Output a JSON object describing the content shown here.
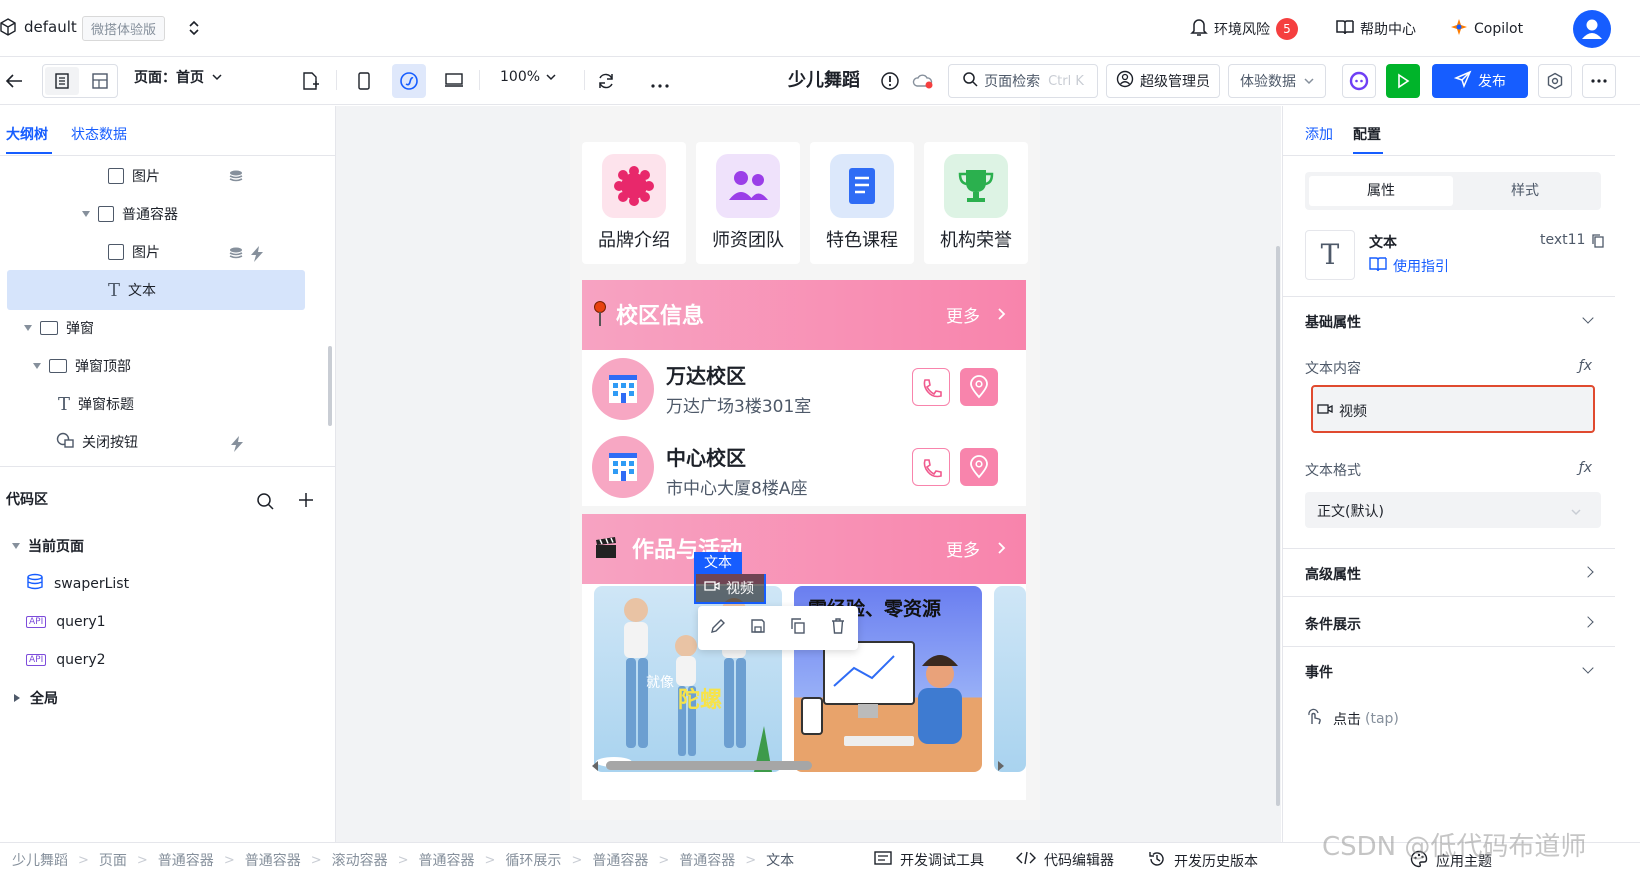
{
  "topbar": {
    "app_name": "default",
    "edition_tag": "微搭体验版",
    "env_risk_label": "环境风险",
    "env_risk_count": "5",
    "help_label": "帮助中心",
    "copilot_label": "Copilot"
  },
  "toolbar": {
    "page_label": "页面：首页",
    "zoom": "100%",
    "app_title": "少儿舞蹈",
    "search_label": "页面检索",
    "search_shortcut": "Ctrl K",
    "user_label": "超级管理员",
    "data_mode": "体验数据",
    "publish_label": "发布"
  },
  "left": {
    "tabs": [
      "大纲树",
      "状态数据"
    ],
    "tree": [
      {
        "label": "图片"
      },
      {
        "label": "普通容器"
      },
      {
        "label": "图片"
      },
      {
        "label": "文本"
      },
      {
        "label": "弹窗"
      },
      {
        "label": "弹窗顶部"
      },
      {
        "label": "弹窗标题"
      },
      {
        "label": "关闭按钮"
      }
    ],
    "code_title": "代码区",
    "current_page": "当前页面",
    "code_items": [
      "swaperList",
      "query1",
      "query2"
    ],
    "global": "全局"
  },
  "canvas": {
    "nav": [
      "品牌介绍",
      "师资团队",
      "特色课程",
      "机构荣誉"
    ],
    "section1": {
      "title": "校区信息",
      "more": "更多"
    },
    "campuses": [
      {
        "name": "万达校区",
        "address": "万达广场3楼301室"
      },
      {
        "name": "中心校区",
        "address": "市中心大厦8楼A座"
      }
    ],
    "section2": {
      "title": "作品与活动",
      "more": "更多"
    },
    "selected_tag": "文本",
    "video_label": "视频",
    "tile1_text": "陀螺",
    "tile1_sub": "就像",
    "tile2_title": "零经验、零资源"
  },
  "right": {
    "tabs": [
      "添加",
      "配置"
    ],
    "seg": [
      "属性",
      "样式"
    ],
    "component_name": "文本",
    "component_id": "text11",
    "guide_label": "使用指引",
    "basic_title": "基础属性",
    "text_content_label": "文本内容",
    "text_content_value": "视频",
    "text_format_label": "文本格式",
    "text_format_value": "正文(默认)",
    "advanced_title": "高级属性",
    "condition_title": "条件展示",
    "events_title": "事件",
    "event_click": "点击",
    "event_tap": "(tap)"
  },
  "bottom": {
    "breadcrumb": [
      "少儿舞蹈",
      "页面",
      "普通容器",
      "普通容器",
      "滚动容器",
      "普通容器",
      "循环展示",
      "普通容器",
      "普通容器",
      "文本"
    ],
    "debug_label": "开发调试工具",
    "code_editor_label": "代码编辑器",
    "history_label": "开发历史版本",
    "theme_label": "应用主题"
  },
  "watermark": "CSDN @低代码布道师",
  "colors": {
    "primary": "#165dff",
    "accent_pink": "#f884ac",
    "run_green": "#00b42a",
    "danger": "#f53f3f"
  }
}
